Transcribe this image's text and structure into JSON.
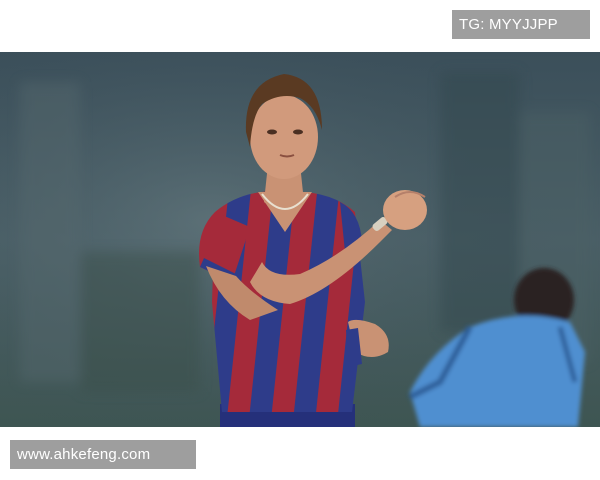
{
  "watermarks": {
    "top_right": "TG: MYYJJPP",
    "bottom_left": "www.ahkefeng.com"
  },
  "photo": {
    "subject": "footballer-in-striped-kit",
    "colors": {
      "background": "#3f5560",
      "kit_red": "#a52a3a",
      "kit_blue": "#2e3c8a",
      "jacket_blue": "#4f8fd0"
    }
  }
}
